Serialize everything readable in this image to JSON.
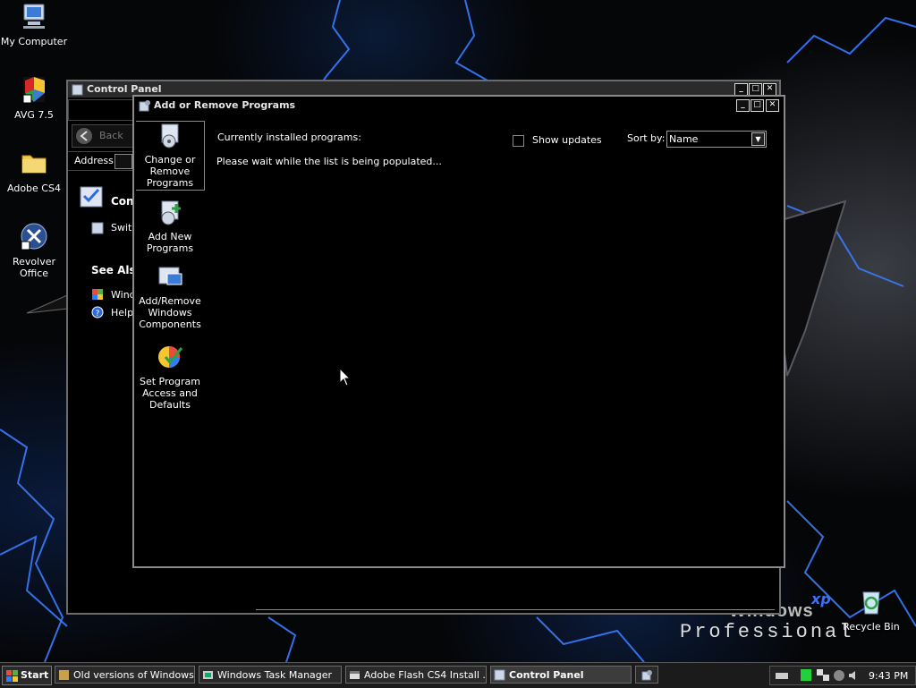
{
  "desktop": {
    "icons": [
      {
        "label": "My Computer"
      },
      {
        "label": "AVG 7.5"
      },
      {
        "label": "Adobe CS4"
      },
      {
        "label": "Revolver Office"
      },
      {
        "label": "Recycle Bin"
      }
    ],
    "watermark": {
      "line1": "Windows",
      "xp": "xp",
      "line2": "Professional"
    }
  },
  "control_panel": {
    "title": "Control Panel",
    "back_label": "Back",
    "address_label": "Address",
    "section_title": "Cont",
    "switch_label": "Switc",
    "see_also": "See Also",
    "see_also_items": [
      "Windo",
      "Help"
    ]
  },
  "arp": {
    "title": "Add or Remove Programs",
    "sidebar": [
      {
        "label": "Change or Remove Programs"
      },
      {
        "label": "Add New Programs"
      },
      {
        "label": "Add/Remove Windows Components"
      },
      {
        "label": "Set Program Access and Defaults"
      }
    ],
    "installed_label": "Currently installed programs:",
    "show_updates_label": "Show updates",
    "sort_by_label": "Sort by:",
    "sort_value": "Name",
    "status": "Please wait while the list is being populated..."
  },
  "taskbar": {
    "start_label": "Start",
    "tasks": [
      {
        "label": "Old versions of Windows..."
      },
      {
        "label": "Windows Task Manager"
      },
      {
        "label": "Adobe Flash CS4 Install ..."
      },
      {
        "label": "Control Panel"
      }
    ],
    "clock": "9:43 PM"
  }
}
